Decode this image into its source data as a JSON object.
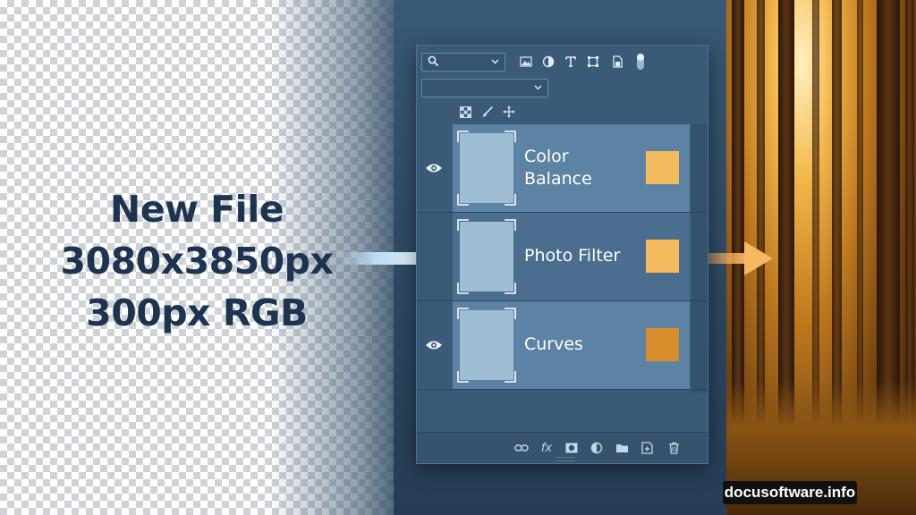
{
  "headline": {
    "line1": "New File",
    "line2": "3080x3850px",
    "line3": "300px RGB"
  },
  "panel": {
    "toolbar_icons": [
      "search-icon",
      "image-icon",
      "adjustment-icon",
      "type-icon",
      "shape-icon",
      "smart-object-icon",
      "filter-toggle"
    ],
    "lock_icons": [
      "lock-transparent-icon",
      "lock-brush-icon",
      "lock-move-icon"
    ],
    "layers": [
      {
        "name_line1": "Color",
        "name_line2": "Balance",
        "visible": true,
        "swatch": "#f4bc5e"
      },
      {
        "name_line1": "Photo Filter",
        "name_line2": "",
        "visible": false,
        "swatch": "#f4bc5e"
      },
      {
        "name_line1": "Curves",
        "name_line2": "",
        "visible": true,
        "swatch": "#d98e2e"
      }
    ],
    "bottom_icons": [
      "link-icon",
      "fx-icon",
      "mask-icon",
      "adjustment-layer-icon",
      "folder-icon",
      "new-layer-icon",
      "trash-icon"
    ],
    "fx_label": "fx"
  },
  "colors": {
    "panel_bg": "#3a5a77",
    "layer_row": "#5c83a4",
    "arrow_blue": "#bfe6ff",
    "arrow_orange": "#f5b15a",
    "headline": "#1d3450"
  },
  "watermark": "docusoftware.info"
}
